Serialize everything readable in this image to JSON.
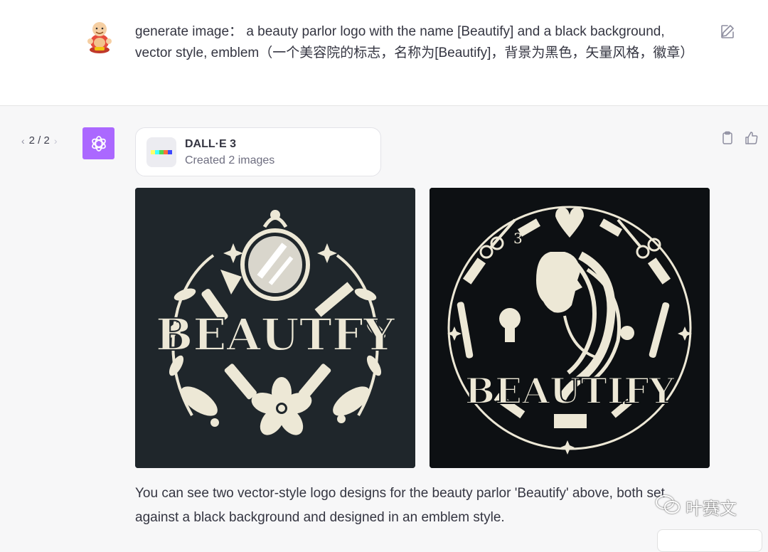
{
  "user": {
    "message": "generate image： a beauty parlor logo with the name [Beautify] and a black background, vector style, emblem（一个美容院的标志，名称为[Beautify]，背景为黑色，矢量风格，徽章）"
  },
  "pager": {
    "prev": "‹",
    "text": "2 / 2",
    "next": "›"
  },
  "tool": {
    "title": "DALL·E 3",
    "subtitle": "Created 2 images"
  },
  "images": [
    {
      "wordmark": "BEAUTFY"
    },
    {
      "wordmark": "BEAUTIFY",
      "number_mark": "3"
    }
  ],
  "assistant": {
    "text": "You can see two vector-style logo designs for the beauty parlor 'Beautify' above, both set against a black background and designed in an emblem style."
  },
  "watermark": {
    "text": "叶赛文"
  },
  "colors": {
    "accent": "#ab68ff",
    "logo_cream": "#ede8d6",
    "image1_bg": "#1f262b",
    "image2_bg": "#0d1013"
  },
  "icons": [
    "user-avatar-icon",
    "edit-icon",
    "chatgpt-logo-icon",
    "dalle-icon",
    "clipboard-icon",
    "thumbs-up-icon",
    "wechat-icon"
  ]
}
